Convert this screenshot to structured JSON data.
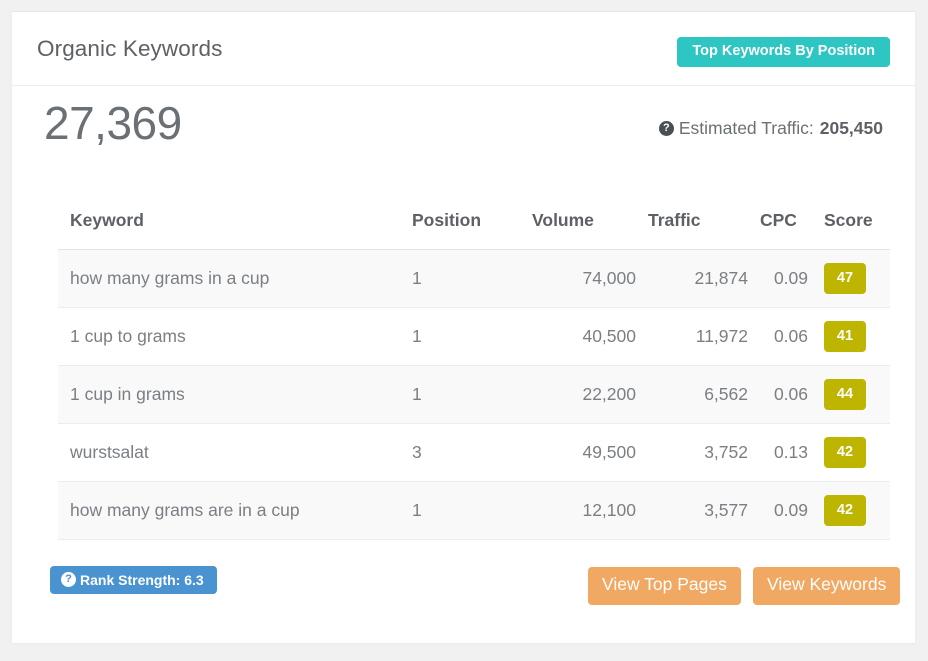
{
  "card": {
    "title": "Organic Keywords",
    "badge_label": "Top Keywords By Position",
    "badge_color": "#2dc6c2"
  },
  "stats": {
    "keyword_count": "27,369",
    "estimated_traffic_label": "Estimated Traffic:",
    "estimated_traffic_value": "205,450",
    "help_icon": "question-circle-icon",
    "help_glyph": "?"
  },
  "table": {
    "headers": [
      "Keyword",
      "Position",
      "Volume",
      "Traffic",
      "CPC",
      "Score"
    ],
    "rows": [
      {
        "keyword": "how many grams in a cup",
        "position": "1",
        "volume": "74,000",
        "traffic": "21,874",
        "cpc": "0.09",
        "score": "47"
      },
      {
        "keyword": "1 cup to grams",
        "position": "1",
        "volume": "40,500",
        "traffic": "11,972",
        "cpc": "0.06",
        "score": "41"
      },
      {
        "keyword": "1 cup in grams",
        "position": "1",
        "volume": "22,200",
        "traffic": "6,562",
        "cpc": "0.06",
        "score": "44"
      },
      {
        "keyword": "wurstsalat",
        "position": "3",
        "volume": "49,500",
        "traffic": "3,752",
        "cpc": "0.13",
        "score": "42"
      },
      {
        "keyword": "how many grams are in a cup",
        "position": "1",
        "volume": "12,100",
        "traffic": "3,577",
        "cpc": "0.09",
        "score": "42"
      }
    ],
    "score_badge_color": "#bdb500"
  },
  "footer": {
    "rank_strength_label": "Rank Strength: 6.3",
    "rank_strength_color": "#4a93d1",
    "view_top_pages_label": "View Top Pages",
    "view_keywords_label": "View Keywords",
    "button_color": "#f0a862",
    "help_glyph": "?"
  }
}
